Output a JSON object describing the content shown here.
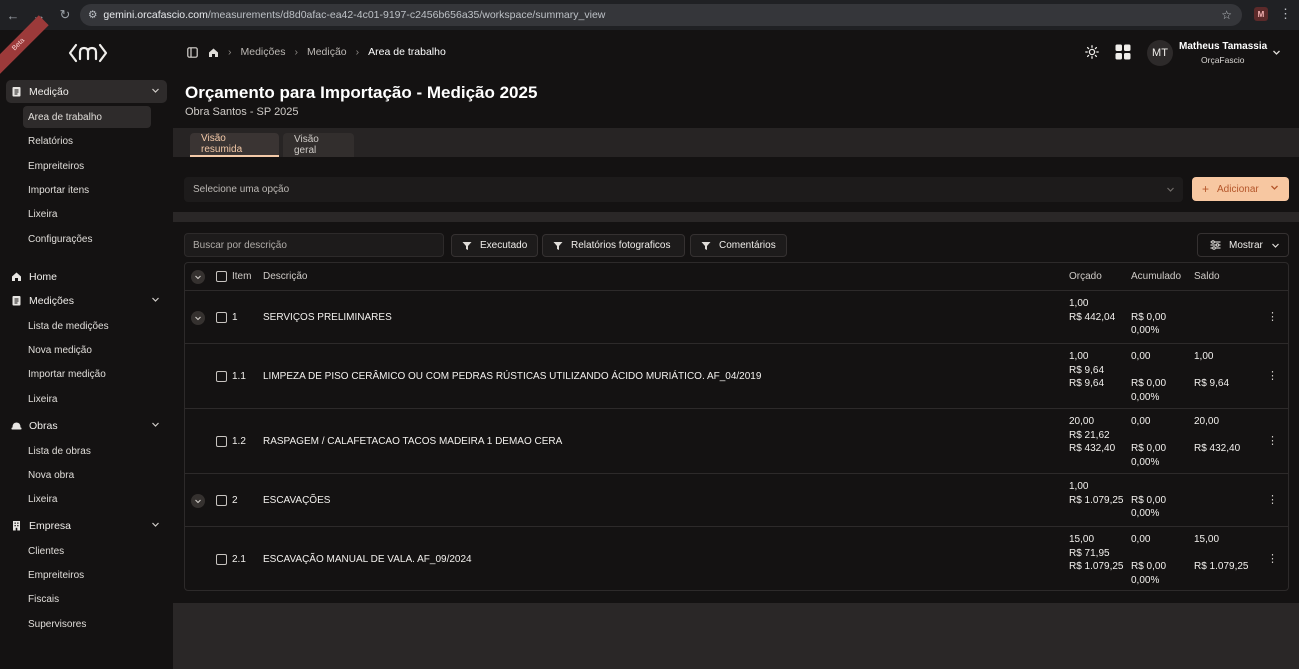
{
  "browser": {
    "url_host": "gemini.orcafascio.com",
    "url_path": "/measurements/d8d0afac-ea42-4c01-9197-c2456b656a35/workspace/summary_view",
    "profile_initial": "M"
  },
  "ribbon_text": "Beta",
  "sidebar": {
    "sections": [
      {
        "label": "Medição",
        "icon": "clipboard-icon",
        "items": [
          "Area de trabalho",
          "Relatórios",
          "Empreiteiros",
          "Importar itens",
          "Lixeira",
          "Configurações"
        ]
      },
      {
        "label": "Home",
        "icon": "home-icon",
        "items": []
      },
      {
        "label": "Medições",
        "icon": "clipboard-icon",
        "items": [
          "Lista de medições",
          "Nova medição",
          "Importar medição",
          "Lixeira"
        ]
      },
      {
        "label": "Obras",
        "icon": "hardhat-icon",
        "items": [
          "Lista de obras",
          "Nova obra",
          "Lixeira"
        ]
      },
      {
        "label": "Empresa",
        "icon": "building-icon",
        "items": [
          "Clientes",
          "Empreiteiros",
          "Fiscais",
          "Supervisores"
        ]
      }
    ]
  },
  "breadcrumbs": [
    "Medições",
    "Medição",
    "Area de trabalho"
  ],
  "user": {
    "initials": "MT",
    "name": "Matheus Tamassia",
    "org": "OrçaFascio"
  },
  "page": {
    "title": "Orçamento para Importação - Medição 2025",
    "subtitle": "Obra Santos - SP 2025"
  },
  "tabs": [
    "Visão resumida",
    "Visão geral"
  ],
  "select": {
    "placeholder": "Selecione uma opção"
  },
  "add_button": "Adicionar",
  "search": {
    "placeholder": "Buscar por descrição"
  },
  "filters": [
    "Executado",
    "Relatórios fotograficos",
    "Comentários"
  ],
  "show_button": "Mostrar",
  "table": {
    "headers": {
      "item": "Item",
      "descricao": "Descrição",
      "orcado": "Orçado",
      "acumulado": "Acumulado",
      "saldo": "Saldo"
    },
    "rows": [
      {
        "item": "1",
        "group": true,
        "descricao": "SERVIÇOS PRELIMINARES",
        "orcado": [
          "1,00",
          "R$ 442,04"
        ],
        "acumulado": [
          "R$ 0,00",
          "0,00%"
        ],
        "saldo": []
      },
      {
        "item": "1.1",
        "group": false,
        "descricao": "LIMPEZA DE PISO CERÂMICO OU COM PEDRAS RÚSTICAS UTILIZANDO ÁCIDO MURIÁTICO. AF_04/2019",
        "orcado": [
          "1,00",
          "R$ 9,64",
          "R$ 9,64"
        ],
        "acumulado": [
          "0,00",
          "R$ 0,00",
          "0,00%"
        ],
        "saldo": [
          "1,00",
          "R$ 9,64"
        ]
      },
      {
        "item": "1.2",
        "group": false,
        "descricao": "RASPAGEM / CALAFETACAO TACOS MADEIRA 1 DEMAO CERA",
        "orcado": [
          "20,00",
          "R$ 21,62",
          "R$ 432,40"
        ],
        "acumulado": [
          "0,00",
          "R$ 0,00",
          "0,00%"
        ],
        "saldo": [
          "20,00",
          "R$ 432,40"
        ]
      },
      {
        "item": "2",
        "group": true,
        "descricao": "ESCAVAÇÕES",
        "orcado": [
          "1,00",
          "R$ 1.079,25"
        ],
        "acumulado": [
          "R$ 0,00",
          "0,00%"
        ],
        "saldo": []
      },
      {
        "item": "2.1",
        "group": false,
        "descricao": "ESCAVAÇÃO MANUAL DE VALA. AF_09/2024",
        "orcado": [
          "15,00",
          "R$ 71,95",
          "R$ 1.079,25"
        ],
        "acumulado": [
          "0,00",
          "R$ 0,00",
          "0,00%"
        ],
        "saldo": [
          "15,00",
          "R$ 1.079,25"
        ]
      }
    ]
  }
}
